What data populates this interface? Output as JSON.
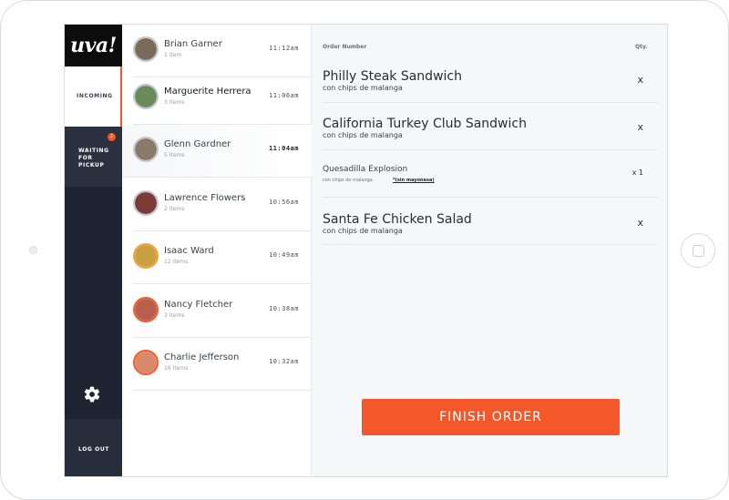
{
  "app": {
    "logo": "uva!"
  },
  "nav": {
    "incoming": "INCOMING",
    "waiting": "WAITING FOR PICKUP",
    "waiting_badge": "2",
    "logout": "LOG OUT",
    "settings_icon": "gear-icon"
  },
  "orders": [
    {
      "name": "Brian Garner",
      "items": "1 item",
      "time": "11:12am",
      "avatar_color": "#7a6a5a"
    },
    {
      "name": "Marguerite Herrera",
      "items": "3 items",
      "time": "11:06am",
      "avatar_color": "#6b8a5a"
    },
    {
      "name": "Glenn Gardner",
      "items": "5 items",
      "time": "11:04am",
      "avatar_color": "#8a7a6a"
    },
    {
      "name": "Lawrence Flowers",
      "items": "2 items",
      "time": "10:56am",
      "avatar_color": "#7a3a3a"
    },
    {
      "name": "Isaac Ward",
      "items": "12 items",
      "time": "10:49am",
      "avatar_color": "#c8a040"
    },
    {
      "name": "Nancy Fletcher",
      "items": "3 items",
      "time": "10:38am",
      "avatar_color": "#b86050"
    },
    {
      "name": "Charlie Jefferson",
      "items": "16 items",
      "time": "10:32am",
      "avatar_color": "#d88a6a"
    }
  ],
  "detail": {
    "order_number_label": "Order Number",
    "qty_label": "Qty.",
    "items": [
      {
        "name": "Philly Steak Sandwich",
        "sub": "con chips de malanga",
        "qty": "x"
      },
      {
        "name": "California Turkey Club Sandwich",
        "sub": "con chips de malanga",
        "qty": "x"
      },
      {
        "name": "Quesadilla Explosion",
        "sub": "con chips de malanga",
        "note": "*(sin mayonesa)",
        "qty": "x 1"
      },
      {
        "name": "Santa Fe Chicken Salad",
        "sub": "con chips de malanga",
        "qty": "x"
      }
    ],
    "finish_label": "FINISH ORDER"
  },
  "colors": {
    "accent": "#f4582a",
    "nav_bg": "#2b3140",
    "panel_bg": "#f6f7f9"
  }
}
